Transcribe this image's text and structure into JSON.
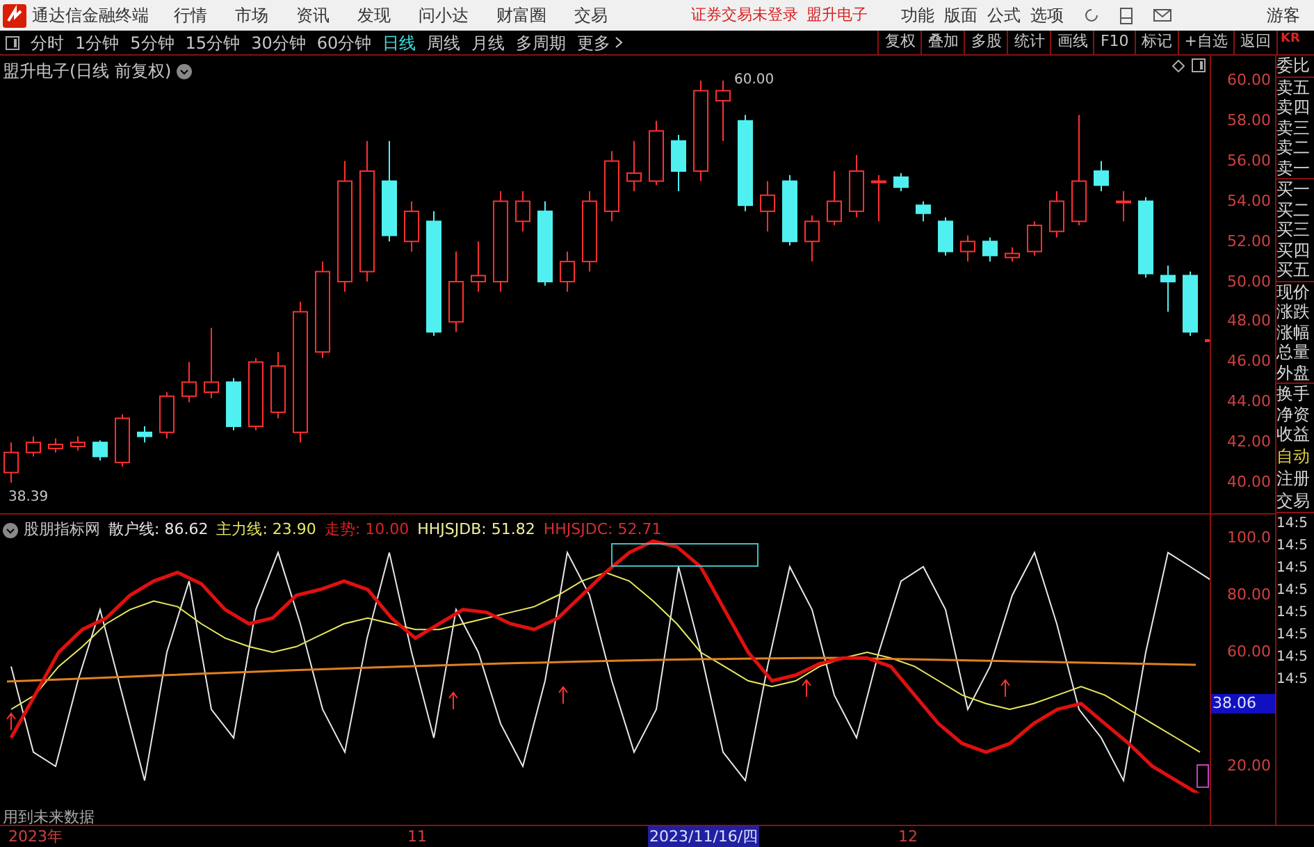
{
  "menu_bar": {
    "app_title": "通达信金融终端",
    "items": [
      "行情",
      "市场",
      "资讯",
      "发现",
      "问小达",
      "财富圈",
      "交易"
    ],
    "notice": "证券交易未登录",
    "stock_name": "盟升电子",
    "right_items": [
      "功能",
      "版面",
      "公式",
      "选项"
    ],
    "user": "游客"
  },
  "period_tabs": [
    {
      "label": "分时",
      "selected": false
    },
    {
      "label": "1分钟",
      "selected": false
    },
    {
      "label": "5分钟",
      "selected": false
    },
    {
      "label": "15分钟",
      "selected": false
    },
    {
      "label": "30分钟",
      "selected": false
    },
    {
      "label": "60分钟",
      "selected": false
    },
    {
      "label": "日线",
      "selected": true
    },
    {
      "label": "周线",
      "selected": false
    },
    {
      "label": "月线",
      "selected": false
    },
    {
      "label": "多周期",
      "selected": false
    },
    {
      "label": "更多",
      "selected": false
    }
  ],
  "tool_buttons": [
    "复权",
    "叠加",
    "多股",
    "统计",
    "画线",
    "F10",
    "标记",
    "+自选",
    "返回"
  ],
  "corner_label": "KR",
  "main_chart": {
    "title": "盟升电子(日线 前复权)",
    "high_label": "60.00",
    "low_label": "38.39",
    "axis_ticks": [
      "60.00",
      "58.00",
      "56.00",
      "54.00",
      "52.00",
      "50.00",
      "48.00",
      "46.00",
      "44.00",
      "42.00",
      "40.00"
    ]
  },
  "indicator": {
    "name": "股朋指标网",
    "legend": [
      {
        "text": "散户线: 86.62",
        "color": "#e8e8e8"
      },
      {
        "text": "主力线: 23.90",
        "color": "#e8e860"
      },
      {
        "text": "走势: 10.00",
        "color": "#e02020"
      },
      {
        "text": "HHJSJDB: 51.82",
        "color": "#f0f0a0"
      },
      {
        "text": "HHJSJDC: 52.71",
        "color": "#d03030"
      }
    ],
    "axis_ticks": [
      "100.0",
      "80.00",
      "60.00",
      "20.00"
    ],
    "current_value": "38.06",
    "footnote": "用到未来数据"
  },
  "side_panel": {
    "quote_labels": [
      "委比",
      "卖五",
      "卖四",
      "卖三",
      "卖二",
      "卖一",
      "买一",
      "买二",
      "买三",
      "买四",
      "买五",
      "现价",
      "涨跌",
      "涨幅",
      "总量",
      "外盘",
      "换手",
      "净资",
      "收益"
    ],
    "tabs": [
      "自动",
      "注册",
      "交易"
    ],
    "times": [
      "14:5",
      "14:5",
      "14:5",
      "14:5",
      "14:5",
      "14:5",
      "14:5",
      "14:5"
    ]
  },
  "date_axis": [
    {
      "label": "2023年",
      "selected": false
    },
    {
      "label": "11",
      "selected": false
    },
    {
      "label": "2023/11/16/四",
      "selected": true
    },
    {
      "label": "12",
      "selected": false
    }
  ]
}
